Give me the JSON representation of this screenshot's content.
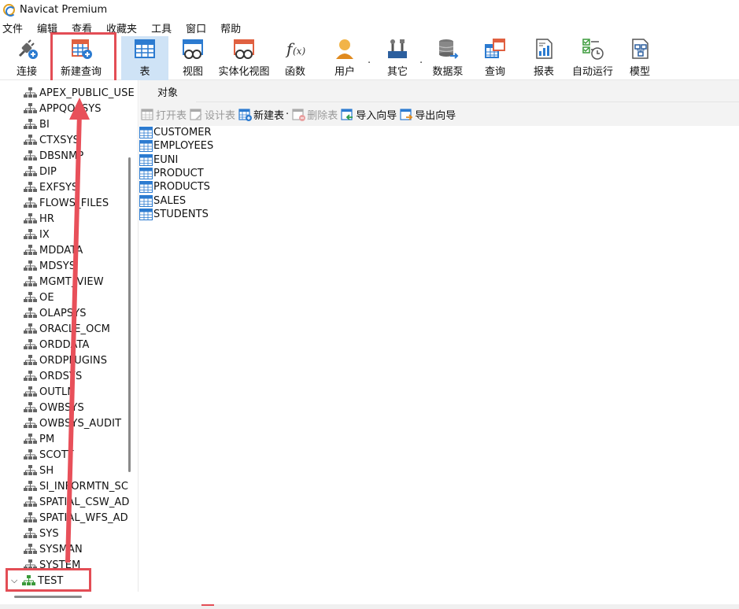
{
  "window": {
    "title": "Navicat Premium"
  },
  "menu": [
    "文件",
    "编辑",
    "查看",
    "收藏夹",
    "工具",
    "窗口",
    "帮助"
  ],
  "toolbar": {
    "connect": "连接",
    "new_query": "新建查询",
    "table": "表",
    "view": "视图",
    "materialized_view": "实体化视图",
    "function": "函数",
    "user": "用户",
    "other": "其它",
    "data_pump": "数据泵",
    "query": "查询",
    "report": "报表",
    "automation": "自动运行",
    "model": "模型"
  },
  "sidebar": {
    "schemas": [
      "APEX_PUBLIC_USE",
      "APPQOSSYS",
      "BI",
      "CTXSYS",
      "DBSNMP",
      "DIP",
      "EXFSYS",
      "FLOWS_FILES",
      "HR",
      "IX",
      "MDDATA",
      "MDSYS",
      "MGMT_VIEW",
      "OE",
      "OLAPSYS",
      "ORACLE_OCM",
      "ORDDATA",
      "ORDPLUGINS",
      "ORDSYS",
      "OUTLN",
      "OWBSYS",
      "OWBSYS_AUDIT",
      "PM",
      "SCOTT",
      "SH",
      "SI_INFORMTN_SC",
      "SPATIAL_CSW_AD",
      "SPATIAL_WFS_AD",
      "SYS",
      "SYSMAN",
      "SYSTEM"
    ],
    "expanded_schema": "TEST"
  },
  "main": {
    "tab": "对象",
    "actions": {
      "open_table": "打开表",
      "design_table": "设计表",
      "new_table": "新建表",
      "delete_table": "删除表",
      "import_wizard": "导入向导",
      "export_wizard": "导出向导"
    },
    "tables": [
      "CUSTOMER",
      "EMPLOYEES",
      "EUNI",
      "PRODUCT",
      "PRODUCTS",
      "SALES",
      "STUDENTS"
    ]
  },
  "colors": {
    "highlight": "#e34d55",
    "active_tab": "#cfe3f6",
    "accent_blue": "#2c7bd0"
  }
}
